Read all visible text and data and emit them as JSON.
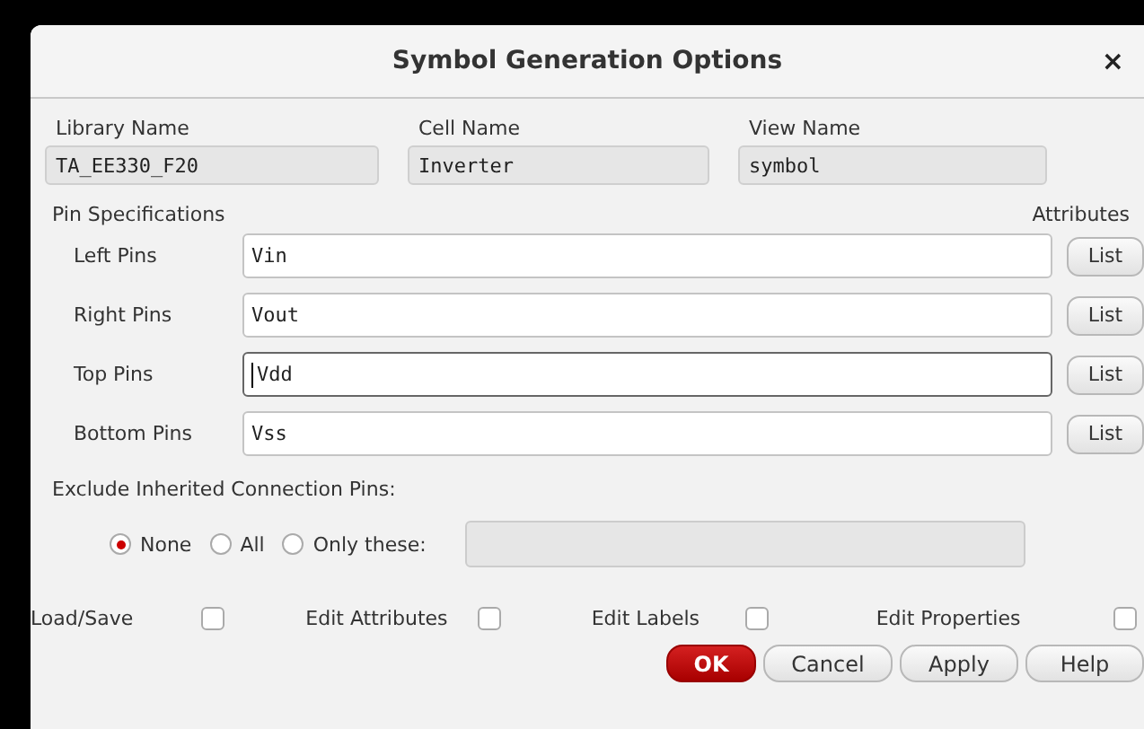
{
  "window": {
    "title": "Symbol Generation Options",
    "close": "×"
  },
  "names": [
    {
      "label": "Library Name",
      "value": "TA_EE330_F20"
    },
    {
      "label": "Cell Name",
      "value": "Inverter"
    },
    {
      "label": "View Name",
      "value": "symbol"
    }
  ],
  "pin_section": {
    "title": "Pin Specifications",
    "attributes_label": "Attributes"
  },
  "pins": [
    {
      "label": "Left Pins",
      "value": "Vin",
      "focused": false,
      "button": "List"
    },
    {
      "label": "Right Pins",
      "value": "Vout",
      "focused": false,
      "button": "List"
    },
    {
      "label": "Top Pins",
      "value": "Vdd",
      "focused": true,
      "button": "List"
    },
    {
      "label": "Bottom Pins",
      "value": "Vss",
      "focused": false,
      "button": "List"
    }
  ],
  "exclude": {
    "title": "Exclude Inherited Connection Pins:",
    "options": [
      {
        "label": "None",
        "selected": true
      },
      {
        "label": "All",
        "selected": false
      },
      {
        "label": "Only these:",
        "selected": false
      }
    ],
    "field_disabled": true
  },
  "toggles": [
    {
      "label": "Load/Save",
      "checked": false
    },
    {
      "label": "Edit Attributes",
      "checked": false
    },
    {
      "label": "Edit Labels",
      "checked": false
    },
    {
      "label": "Edit Properties",
      "checked": false
    }
  ],
  "buttons": [
    {
      "label": "OK",
      "kind": "primary"
    },
    {
      "label": "Cancel",
      "kind": "normal"
    },
    {
      "label": "Apply",
      "kind": "normal"
    },
    {
      "label": "Help",
      "kind": "normal"
    }
  ]
}
